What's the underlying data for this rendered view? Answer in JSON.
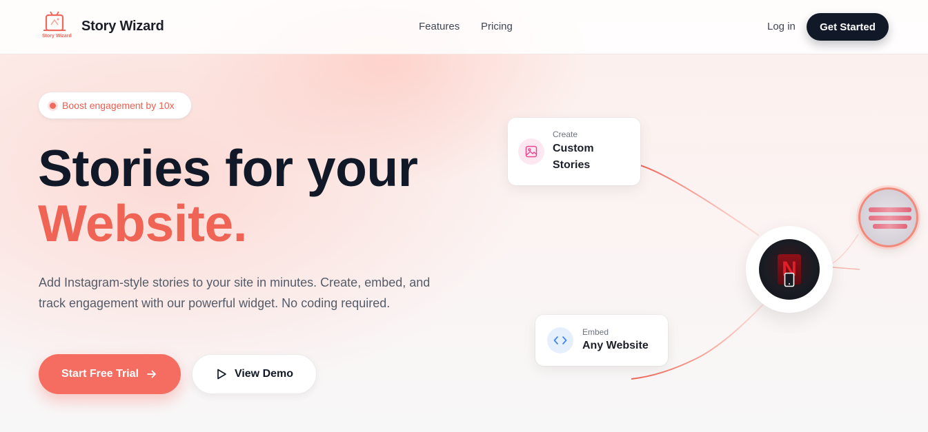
{
  "header": {
    "logo_caption": "Story Wizard",
    "brand": "Story Wizard",
    "nav": [
      "Features",
      "Pricing"
    ],
    "login": "Log in",
    "cta": "Get Started"
  },
  "hero": {
    "badge": "Boost engagement by 10x",
    "title_line1": "Stories for your",
    "title_line2": "Website.",
    "description": "Add Instagram-style stories to your site in minutes. Create, embed, and track engagement with our powerful widget. No coding required.",
    "primary_button": "Start Free Trial",
    "secondary_button": "View Demo"
  },
  "visual": {
    "create_card": {
      "small": "Create",
      "line1": "Custom",
      "line2": "Stories",
      "icon": "image-icon"
    },
    "embed_card": {
      "small": "Embed",
      "title": "Any Website",
      "icon": "code-icon"
    },
    "center": {
      "logo_letter": "N",
      "icon": "phone-icon"
    },
    "story_thumb": {
      "icon": "story-thumbnail"
    }
  },
  "colors": {
    "accent": "#f46d60",
    "dark": "#111827",
    "text_muted": "#545c69"
  }
}
